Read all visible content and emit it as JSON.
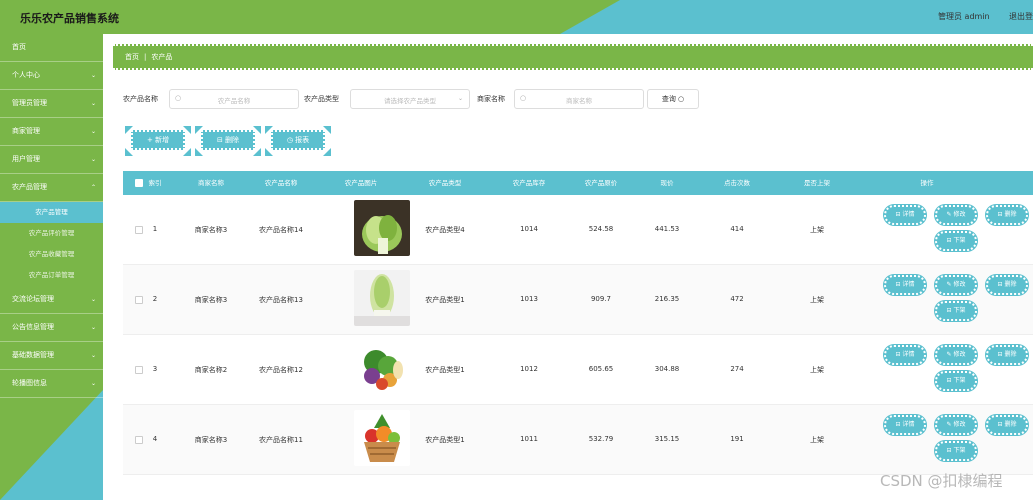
{
  "header": {
    "title": "乐乐农产品销售系统",
    "user": "管理员 admin",
    "logout": "退出登"
  },
  "sidebar": {
    "items": [
      {
        "label": "首页",
        "chevron": ""
      },
      {
        "label": "个人中心",
        "chevron": "⌄"
      },
      {
        "label": "管理员管理",
        "chevron": "⌄"
      },
      {
        "label": "商家管理",
        "chevron": "⌄"
      },
      {
        "label": "用户管理",
        "chevron": "⌄"
      },
      {
        "label": "农产品管理",
        "chevron": "⌃"
      }
    ],
    "sub_items": [
      {
        "label": "农产品管理",
        "active": true
      },
      {
        "label": "农产品评价管理",
        "active": false
      },
      {
        "label": "农产品收藏管理",
        "active": false
      },
      {
        "label": "农产品订单管理",
        "active": false
      }
    ],
    "items_after": [
      {
        "label": "交流论坛管理",
        "chevron": "⌄"
      },
      {
        "label": "公告信息管理",
        "chevron": "⌄"
      },
      {
        "label": "基础数据管理",
        "chevron": "⌄"
      },
      {
        "label": "轮播图信息",
        "chevron": "⌄"
      }
    ]
  },
  "breadcrumb": {
    "home": "首页",
    "sep": "|",
    "current": "农产品"
  },
  "search": {
    "name_label": "农产品名称",
    "name_placeholder": "农产品名称",
    "type_label": "农产品类型",
    "type_placeholder": "请选择农产品类型",
    "shop_label": "商家名称",
    "shop_placeholder": "商家名称",
    "button": "查询 ○"
  },
  "actions": {
    "add": "+ 新增",
    "delete": "⊟ 删除",
    "report": "◷ 报表"
  },
  "table": {
    "headers": [
      "索引",
      "商家名称",
      "农产品名称",
      "农产品图片",
      "农产品类型",
      "农产品库存",
      "农产品原价",
      "现价",
      "点击次数",
      "是否上架",
      "操作"
    ],
    "rows": [
      {
        "index": "1",
        "shop": "商家名称3",
        "name": "农产品名称14",
        "image": "lettuce",
        "type": "农产品类型4",
        "stock": "1014",
        "orig_price": "524.58",
        "price": "441.53",
        "clicks": "414",
        "status": "上架"
      },
      {
        "index": "2",
        "shop": "商家名称3",
        "name": "农产品名称13",
        "image": "cabbage",
        "type": "农产品类型1",
        "stock": "1013",
        "orig_price": "909.7",
        "price": "216.35",
        "clicks": "472",
        "status": "上架"
      },
      {
        "index": "3",
        "shop": "商家名称2",
        "name": "农产品名称12",
        "image": "vegetables",
        "type": "农产品类型1",
        "stock": "1012",
        "orig_price": "605.65",
        "price": "304.88",
        "clicks": "274",
        "status": "上架"
      },
      {
        "index": "4",
        "shop": "商家名称3",
        "name": "农产品名称11",
        "image": "basket",
        "type": "农产品类型1",
        "stock": "1011",
        "orig_price": "532.79",
        "price": "315.15",
        "clicks": "191",
        "status": "上架"
      }
    ],
    "ops": {
      "detail": "⊟ 详情",
      "edit": "✎ 修改",
      "delete": "⊟ 删除",
      "offshelf": "⊟ 下架"
    }
  },
  "watermark": "CSDN @扣棣编程",
  "colors": {
    "green": "#7ab648",
    "teal": "#5bc0cf"
  }
}
